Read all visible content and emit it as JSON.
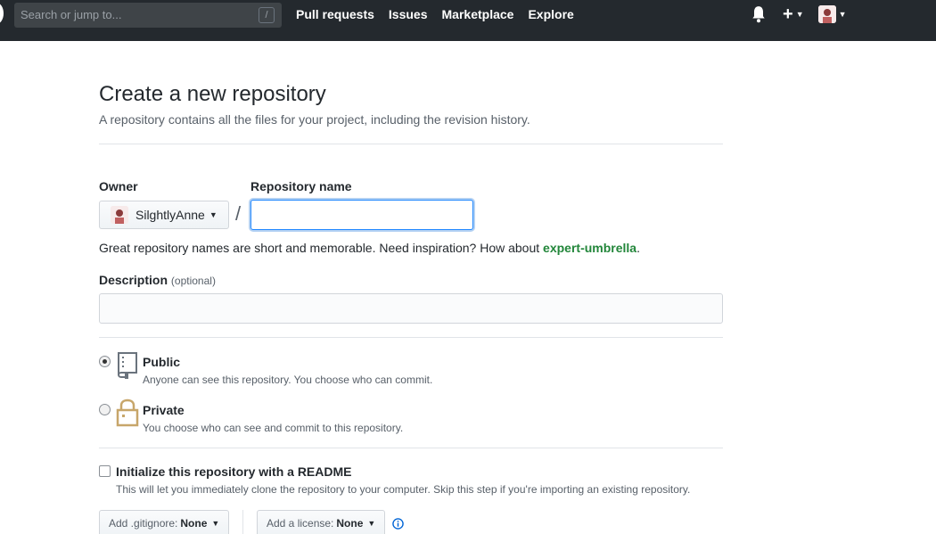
{
  "header": {
    "search_placeholder": "Search or jump to...",
    "search_key": "/",
    "nav": [
      "Pull requests",
      "Issues",
      "Marketplace",
      "Explore"
    ],
    "plus": "+"
  },
  "page": {
    "title": "Create a new repository",
    "subtitle": "A repository contains all the files for your project, including the revision history."
  },
  "owner": {
    "label": "Owner",
    "name": "SilghtlyAnne"
  },
  "repo_name": {
    "label": "Repository name",
    "separator": "/",
    "value": ""
  },
  "hint": {
    "text": "Great repository names are short and memorable. Need inspiration? How about ",
    "suggestion": "expert-umbrella",
    "end": "."
  },
  "description": {
    "label": "Description",
    "optional": "(optional)",
    "value": ""
  },
  "visibility": {
    "public": {
      "title": "Public",
      "desc": "Anyone can see this repository. You choose who can commit.",
      "checked": true
    },
    "private": {
      "title": "Private",
      "desc": "You choose who can see and commit to this repository.",
      "checked": false
    }
  },
  "readme": {
    "title": "Initialize this repository with a README",
    "desc": "This will let you immediately clone the repository to your computer. Skip this step if you're importing an existing repository.",
    "checked": false
  },
  "gitignore": {
    "label": "Add .gitignore:",
    "value": "None"
  },
  "license": {
    "label": "Add a license:",
    "value": "None"
  },
  "colors": {
    "header_bg": "#24292e",
    "suggestion": "#22863a",
    "focus": "#2188ff"
  }
}
